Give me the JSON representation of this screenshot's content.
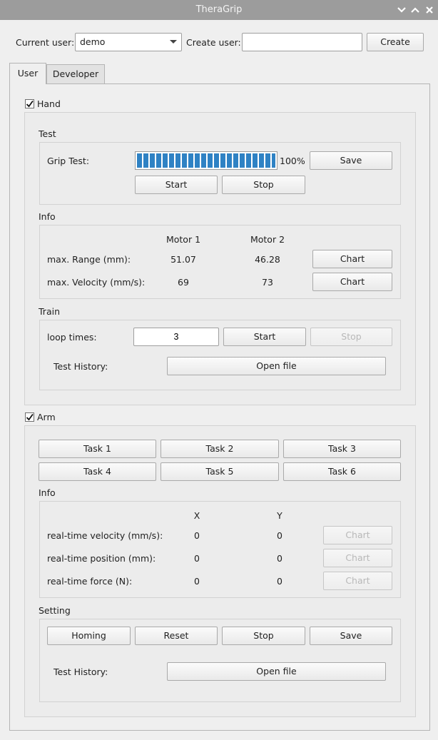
{
  "window": {
    "title": "TheraGrip"
  },
  "top": {
    "current_user_label": "Current user:",
    "current_user_value": "demo",
    "create_user_label": "Create user:",
    "create_user_value": "",
    "create_button": "Create"
  },
  "tabs": [
    {
      "label": "User",
      "active": true
    },
    {
      "label": "Developer",
      "active": false
    }
  ],
  "hand": {
    "label": "Hand",
    "checked": true,
    "test": {
      "title": "Test",
      "grip_label": "Grip Test:",
      "progress_percent": 100,
      "progress_text": "100%",
      "save": "Save",
      "start": "Start",
      "stop": "Stop"
    },
    "info": {
      "title": "Info",
      "col1": "Motor 1",
      "col2": "Motor 2",
      "rows": [
        {
          "label": "max. Range (mm):",
          "v1": "51.07",
          "v2": "46.28",
          "button": "Chart"
        },
        {
          "label": "max. Velocity (mm/s):",
          "v1": "69",
          "v2": "73",
          "button": "Chart"
        }
      ]
    },
    "train": {
      "title": "Train",
      "loop_label": "loop times:",
      "loop_value": "3",
      "start": "Start",
      "stop": "Stop",
      "history_label": "Test History:",
      "open_file": "Open file"
    }
  },
  "arm": {
    "label": "Arm",
    "checked": true,
    "tasks": [
      "Task 1",
      "Task 2",
      "Task 3",
      "Task 4",
      "Task 5",
      "Task 6"
    ],
    "info": {
      "title": "Info",
      "col1": "X",
      "col2": "Y",
      "rows": [
        {
          "label": "real-time velocity (mm/s):",
          "v1": "0",
          "v2": "0",
          "button": "Chart"
        },
        {
          "label": "real-time position (mm):",
          "v1": "0",
          "v2": "0",
          "button": "Chart"
        },
        {
          "label": "real-time force (N):",
          "v1": "0",
          "v2": "0",
          "button": "Chart"
        }
      ]
    },
    "setting": {
      "title": "Setting",
      "homing": "Homing",
      "reset": "Reset",
      "stop": "Stop",
      "save": "Save",
      "history_label": "Test History:",
      "open_file": "Open file"
    }
  },
  "colors": {
    "progress": "#2f82c4",
    "titlebar": "#9c9c9c",
    "background": "#efefef"
  },
  "icons": [
    "chevron-down-icon",
    "chevron-up-icon",
    "close-icon",
    "checkmark-icon",
    "dropdown-arrow-icon"
  ]
}
